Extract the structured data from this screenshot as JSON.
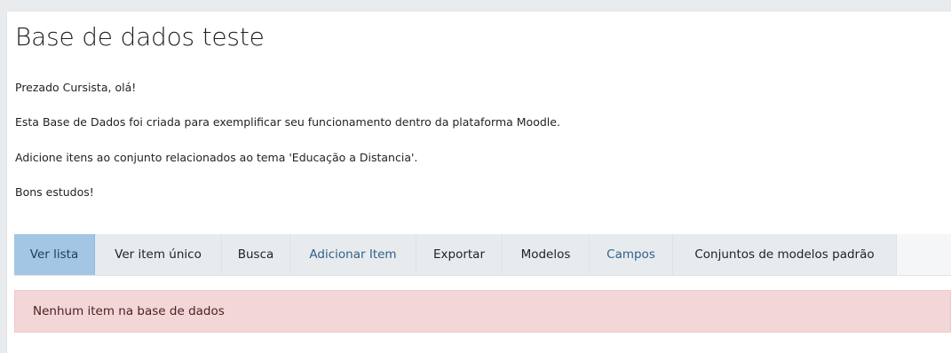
{
  "title": "Base de dados teste",
  "intro": [
    "Prezado Cursista, olá!",
    "Esta Base de Dados foi criada para exemplificar seu funcionamento dentro da plataforma Moodle.",
    "Adicione itens ao conjunto relacionados ao tema 'Educação a Distancia'.",
    "Bons estudos!"
  ],
  "tabs": [
    {
      "label": "Ver lista",
      "active": true
    },
    {
      "label": "Ver item único",
      "active": false
    },
    {
      "label": "Busca",
      "active": false
    },
    {
      "label": "Adicionar Item",
      "active": false
    },
    {
      "label": "Exportar",
      "active": false
    },
    {
      "label": "Modelos",
      "active": false
    },
    {
      "label": "Campos",
      "active": false
    },
    {
      "label": "Conjuntos de modelos padrão",
      "active": false
    }
  ],
  "alert": {
    "message": "Nenhum item na base de dados"
  },
  "colors": {
    "active_tab": "#a2c6e4",
    "tab_background": "#e8ebee",
    "alert_background": "#f3d6d7",
    "link_text": "#2f5f8a"
  }
}
